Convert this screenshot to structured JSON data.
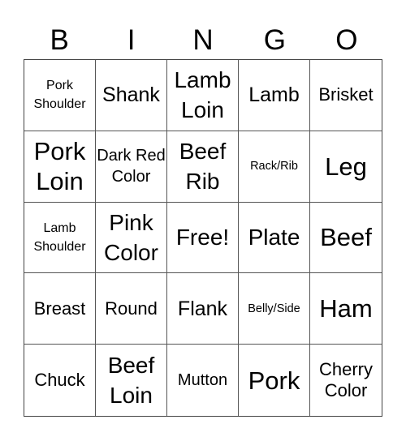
{
  "header": [
    "B",
    "I",
    "N",
    "G",
    "O"
  ],
  "cells": [
    {
      "text": "Pork Shoulder",
      "size": "s-s"
    },
    {
      "text": "Shank",
      "size": "s-m"
    },
    {
      "text": "Lamb Loin",
      "size": "s-l"
    },
    {
      "text": "Lamb",
      "size": "s-m"
    },
    {
      "text": "Brisket",
      "size": "s-ms"
    },
    {
      "text": "Pork Loin",
      "size": "s-xl"
    },
    {
      "text": "Dark Red Color",
      "size": "s-sd"
    },
    {
      "text": "Beef Rib",
      "size": "s-l"
    },
    {
      "text": "Rack/Rib",
      "size": "s-xs"
    },
    {
      "text": "Leg",
      "size": "s-xl"
    },
    {
      "text": "Lamb Shoulder",
      "size": "s-s"
    },
    {
      "text": "Pink Color",
      "size": "s-l"
    },
    {
      "text": "Free!",
      "size": "s-l"
    },
    {
      "text": "Plate",
      "size": "s-l"
    },
    {
      "text": "Beef",
      "size": "s-xl"
    },
    {
      "text": "Breast",
      "size": "s-ms"
    },
    {
      "text": "Round",
      "size": "s-ms"
    },
    {
      "text": "Flank",
      "size": "s-m"
    },
    {
      "text": "Belly/Side",
      "size": "s-xs"
    },
    {
      "text": "Ham",
      "size": "s-xl"
    },
    {
      "text": "Chuck",
      "size": "s-ms"
    },
    {
      "text": "Beef Loin",
      "size": "s-l"
    },
    {
      "text": "Mutton",
      "size": "s-sd"
    },
    {
      "text": "Pork",
      "size": "s-xl"
    },
    {
      "text": "Cherry Color",
      "size": "s-ms"
    }
  ]
}
